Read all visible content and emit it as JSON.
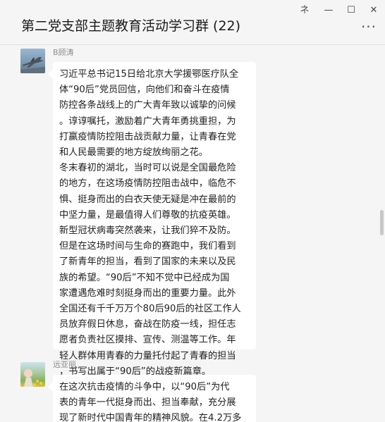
{
  "window": {
    "title": "第二党支部主题教育活动学习群 (22)",
    "buttons": {
      "pin": "ネ",
      "minimize": "—",
      "maximize": "☐",
      "close": "✕",
      "more": "···"
    }
  },
  "messages": [
    {
      "sender": "B顾涛",
      "avatar_icon": "fighter-jet-avatar",
      "lines": [
        "习近平总书记15日给北京大学援鄂医疗队全",
        "体“90后”党员回信，向他们和奋斗在疫情",
        "防控各条战线上的广大青年致以诚挚的问候",
        "。谆谆嘱托，激励着广大青年勇挑重担，为",
        "打赢疫情防控阻击战贡献力量，让青春在党",
        "和人民最需要的地方绽放绚丽之花。",
        "冬末春初的湖北，当时可以说是全国最危险",
        "的地方，在这场疫情防控阻击战中，临危不",
        "惧、挺身而出的白衣天使无疑是冲在最前的",
        "中坚力量，是最值得人们尊敬的抗疫英雄。",
        "新型冠状病毒突然袭来，让我们猝不及防。",
        "但是在这场时间与生命的赛跑中，我们看到",
        "了新青年的担当，看到了国家的未来以及民",
        "族的希望。“90后”不知不觉中已经成为国",
        "家遭遇危难时刻挺身而出的重要力量。此外",
        "全国还有千千万万个80后90后的社区工作人",
        "员放弃假日休息，奋战在防疫一线，担任志",
        "愿者负责社区摸排、宣传、测温等工作。年",
        "轻人群体用青春的力量托付起了青春的担当",
        "，书写出属于“90后”的战疫新篇章。"
      ]
    },
    {
      "sender": "远亚丽",
      "avatar_icon": "flower-field-avatar",
      "lines": [
        "在这次抗击疫情的斗争中，以“90后”为代",
        "表的青年一代挺身而出、担当奉献，充分展",
        "现了新时代中国青年的精神风貌。在4.2万多"
      ]
    }
  ],
  "colors": {
    "background": "#f5f5f5",
    "bubble": "#ffffff",
    "text": "#222222",
    "sender": "#8a8a8a"
  }
}
